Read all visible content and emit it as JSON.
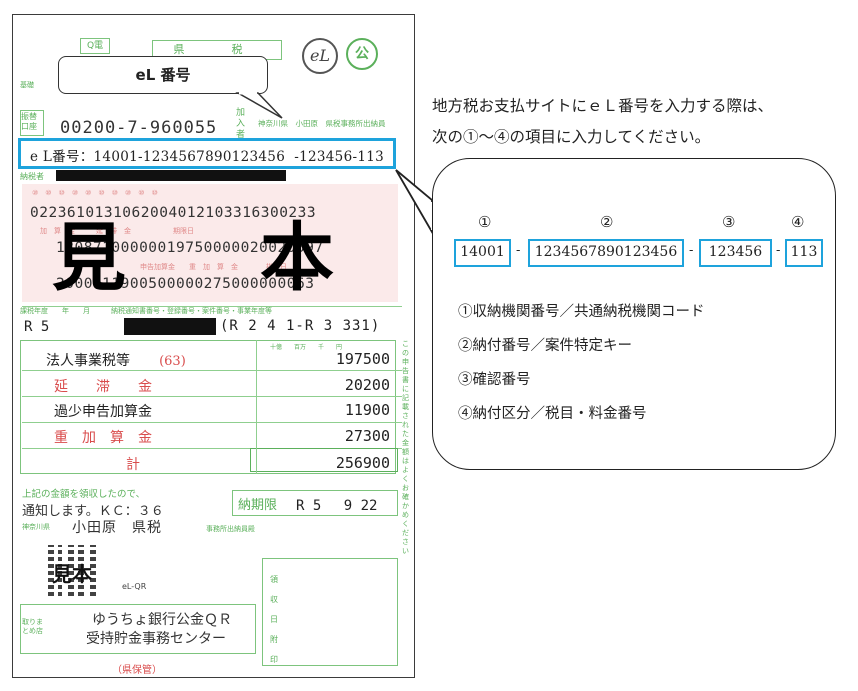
{
  "balloon_label": "eL 番号",
  "slip": {
    "top_badge": "Q電",
    "top_box": "県　税",
    "logo_el": "eL",
    "logo_ko": "公",
    "furikae_label": "振替口座",
    "account_number": "00200-7-960055",
    "kanyu_label": "加入者",
    "payee_small": "神奈川県　小田原　県税事務所出納員",
    "el_number_line": "e L番号：14001-1234567890123456  -123456-113",
    "nozeisha_label": "納税者",
    "ocr_line1": "02236101310620040121033163002​33",
    "ocr_line2": "13087100000019750000020020097",
    "ocr_line3": "2000011900500000275000000063",
    "watermark": "見　本",
    "year_label": "R 5",
    "period": "(R 2 4 1-R 3 331)",
    "items": [
      {
        "label": "法人事業税等",
        "code": "(63)",
        "amount": "197500"
      },
      {
        "label": "延　　滞　　金",
        "code": "",
        "amount": "20200"
      },
      {
        "label": "過少申告加算金",
        "code": "",
        "amount": "11900"
      },
      {
        "label": "重　加　算　金",
        "code": "",
        "amount": "27300"
      },
      {
        "label": "計",
        "code": "",
        "amount": "256900"
      }
    ],
    "notice_line1": "上記の金額を領収したので、",
    "notice_line2": "通知します。ＫＣ：３６",
    "office": "小田原　県税",
    "office_small": "事務所出納員殿",
    "deadline_label": "納期限",
    "deadline": "R 5　 9 22",
    "qr_label": "eL-QR",
    "qr_watermark": "見本",
    "bank_label": "取りまとめ店",
    "bank_line1": "ゆうちょ銀行公金ＱＲ",
    "bank_line2": "受持貯金事務センター",
    "stamp_label": "領収日附印",
    "footer": "（県保管）"
  },
  "explanation": {
    "line1": "地方税お支払サイトにｅＬ番号を入力する際は、",
    "line2": "次の①～④の項目に入力してください。",
    "markers": [
      "①",
      "②",
      "③",
      "④"
    ],
    "parts": [
      "14001",
      "1234567890123456",
      "123456",
      "113"
    ],
    "separator": "-",
    "legend": [
      "①収納機関番号／共通納税機関コード",
      "②納付番号／案件特定キー",
      "③確認番号",
      "④納付区分／税目・料金番号"
    ]
  }
}
